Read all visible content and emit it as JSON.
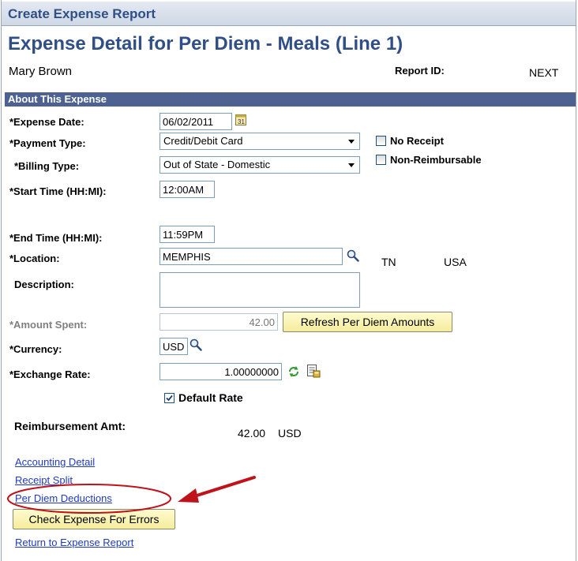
{
  "header": {
    "title": "Create Expense Report"
  },
  "page": {
    "title": "Expense Detail for Per Diem - Meals (Line 1)",
    "employee_name": "Mary Brown",
    "report_id_label": "Report ID:",
    "report_id_value": "NEXT"
  },
  "section": {
    "title": "About This Expense"
  },
  "form": {
    "expense_date": {
      "label": "*Expense Date:",
      "value": "06/02/2011"
    },
    "payment_type": {
      "label": "*Payment Type:",
      "value": "Credit/Debit Card"
    },
    "billing_type": {
      "label": "*Billing Type:",
      "value": "Out of State - Domestic"
    },
    "start_time": {
      "label": "*Start Time (HH:MI):",
      "value": "12:00AM"
    },
    "end_time": {
      "label": "*End Time (HH:MI):",
      "value": "11:59PM"
    },
    "location": {
      "label": "*Location:",
      "value": "MEMPHIS",
      "state": "TN",
      "country": "USA"
    },
    "description": {
      "label": "Description:",
      "value": ""
    },
    "amount_spent": {
      "label": "*Amount Spent:",
      "value": "42.00"
    },
    "currency": {
      "label": "*Currency:",
      "value": "USD"
    },
    "exchange_rate": {
      "label": "*Exchange Rate:",
      "value": "1.00000000"
    },
    "default_rate": {
      "label": "Default Rate",
      "checked": true
    },
    "no_receipt": {
      "label": "No Receipt",
      "checked": false
    },
    "non_reimbursable": {
      "label": "Non-Reimbursable",
      "checked": false
    },
    "reimbursement": {
      "label": "Reimbursement Amt:",
      "amount": "42.00",
      "currency": "USD"
    }
  },
  "buttons": {
    "refresh_per_diem": "Refresh Per Diem Amounts",
    "check_errors": "Check Expense For Errors"
  },
  "links": {
    "accounting_detail": "Accounting Detail",
    "receipt_split": "Receipt Split",
    "per_diem_deductions": "Per Diem Deductions",
    "return_to_report": "Return to Expense Report"
  },
  "icons": {
    "calendar": "calendar-icon",
    "lookup": "magnifier-icon",
    "refresh": "refresh-icon",
    "rate_detail": "rate-detail-icon"
  },
  "colors": {
    "title": "#2f4f86",
    "section_bar": "#4d6291",
    "link": "#1f3bbf",
    "button": "#f5ec9a",
    "annotation": "#c0121a"
  }
}
